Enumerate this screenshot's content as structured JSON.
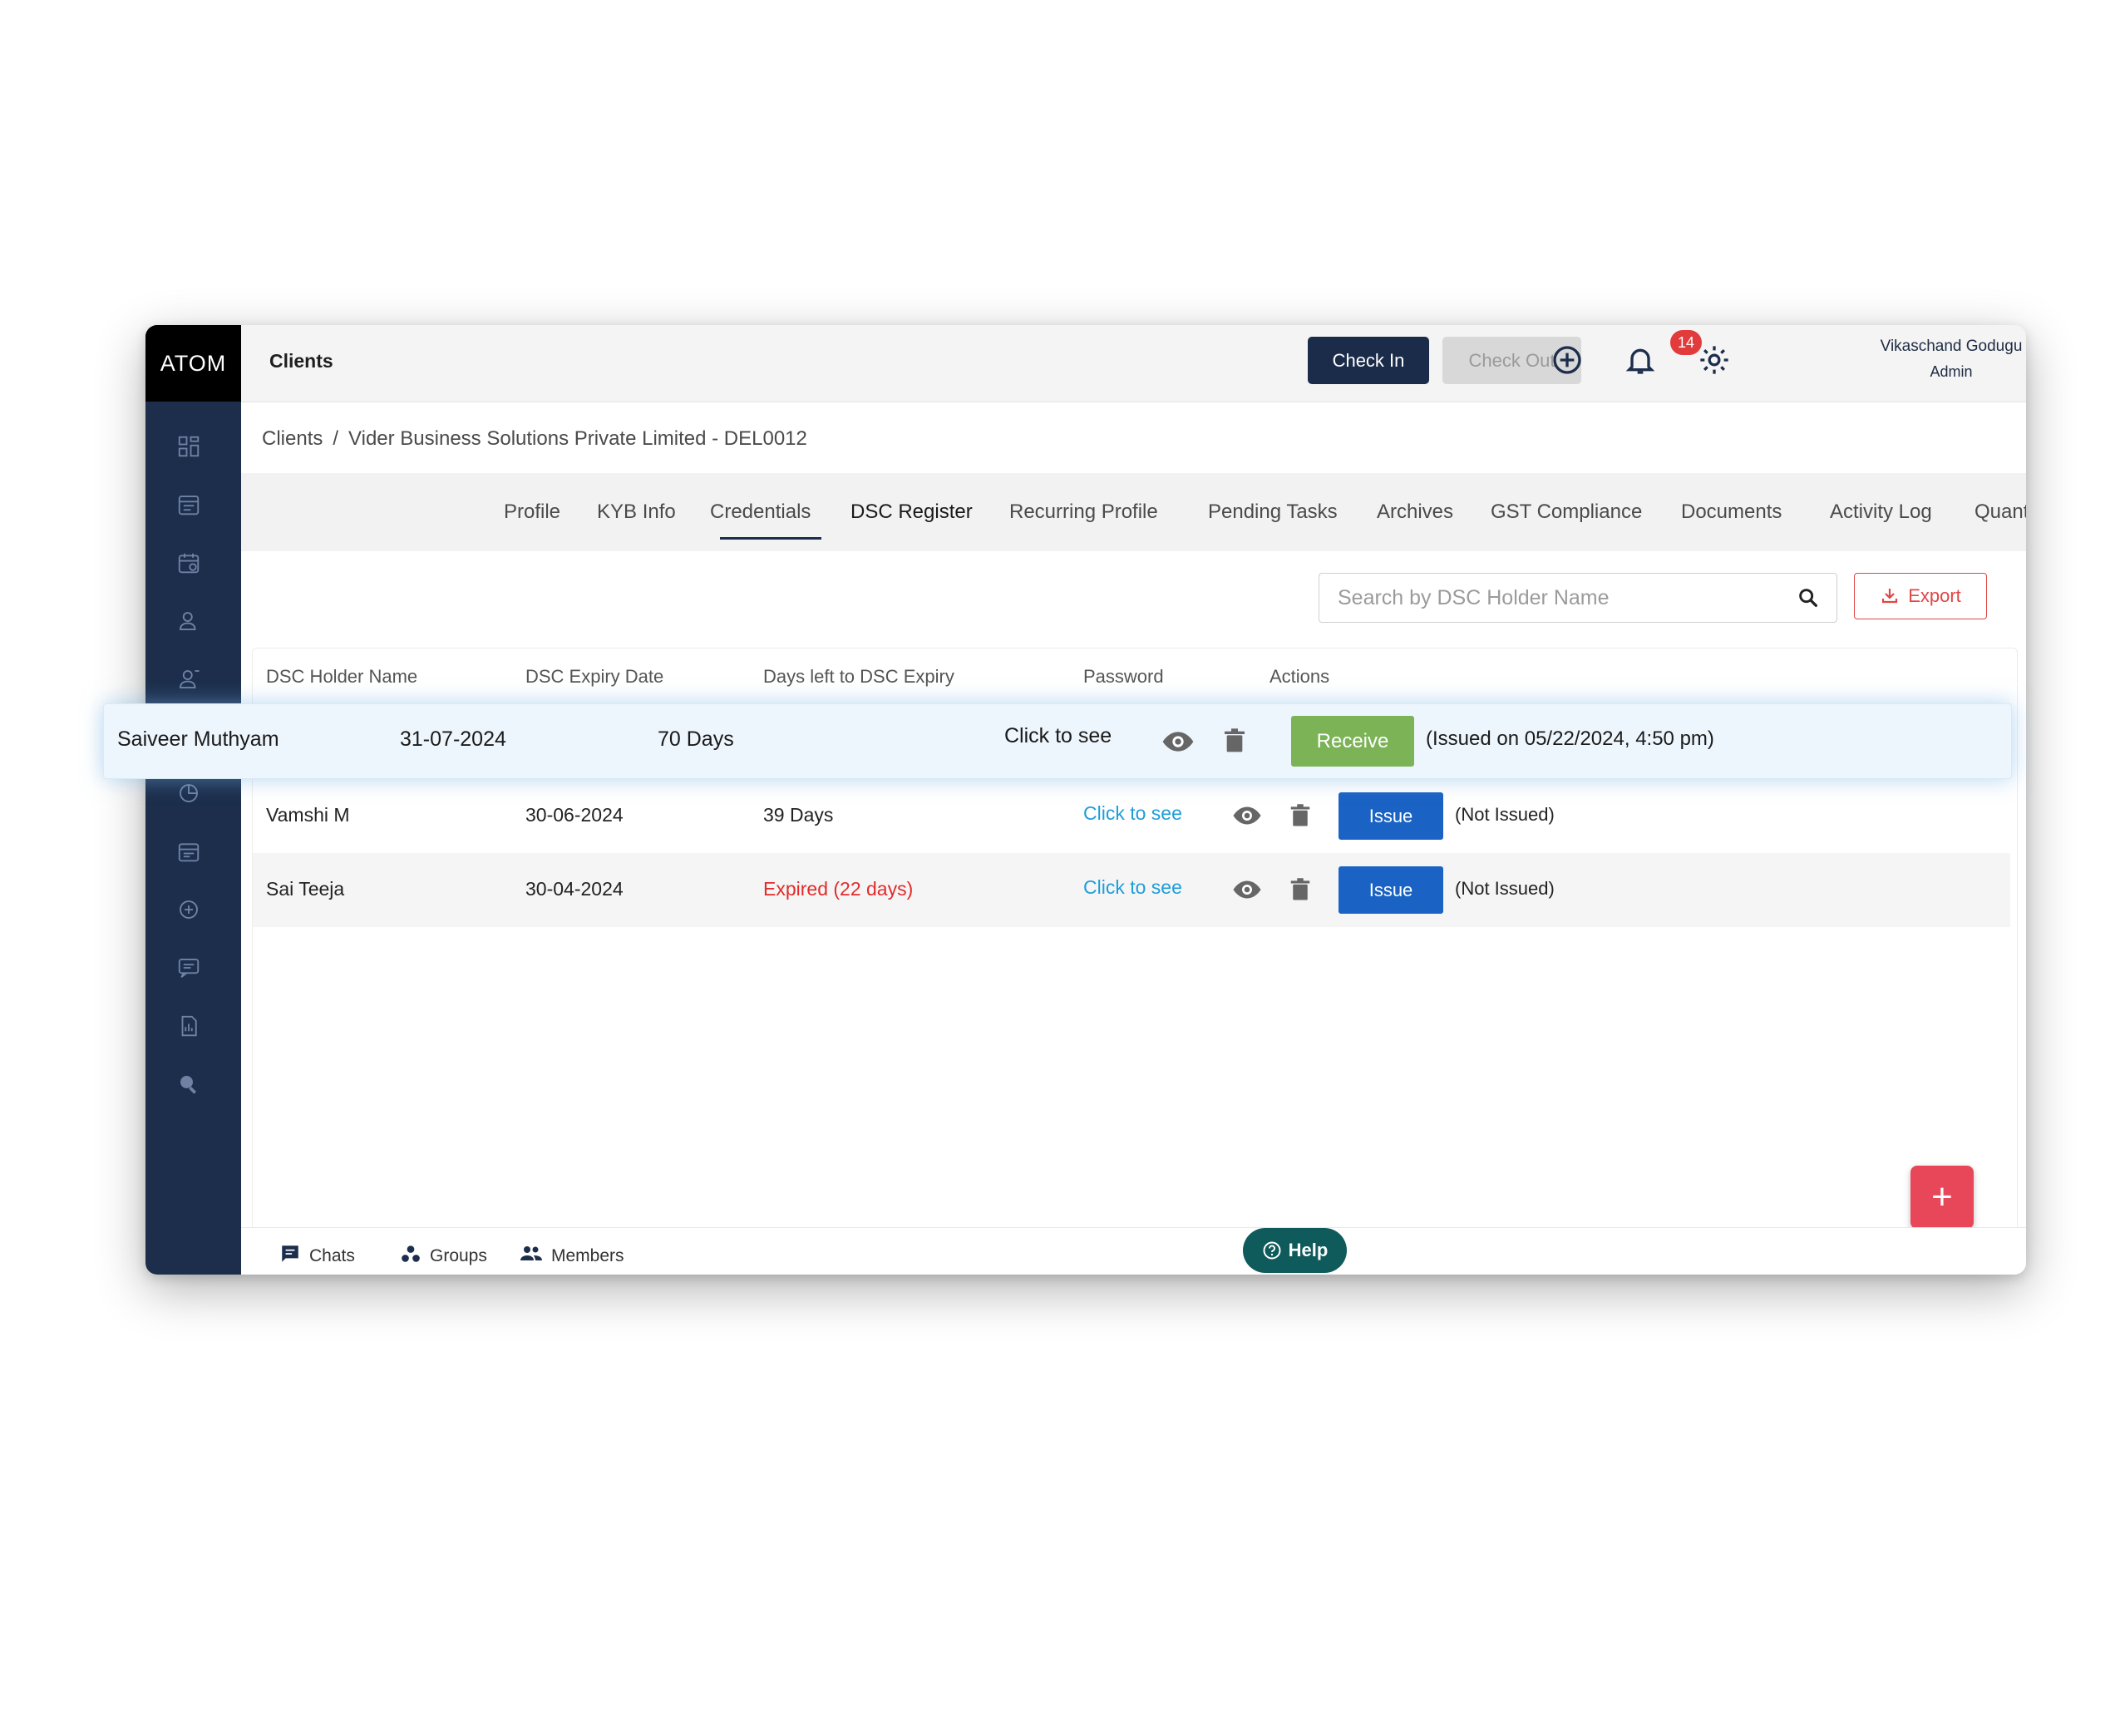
{
  "app": {
    "logo": "ATOM",
    "section_title": "Clients"
  },
  "topbar": {
    "check_in": "Check In",
    "check_out": "Check Out",
    "notification_count": "14",
    "user_name": "Vikaschand Godugu",
    "user_role": "Admin"
  },
  "breadcrumb": {
    "root": "Clients",
    "separator": "/",
    "current": "Vider Business Solutions Private Limited - DEL0012"
  },
  "tabs": [
    "Profile",
    "KYB Info",
    "Credentials",
    "DSC Register",
    "Recurring Profile",
    "Pending Tasks",
    "Archives",
    "GST Compliance",
    "Documents",
    "Activity Log",
    "Quantum"
  ],
  "active_tab": "DSC Register",
  "search": {
    "placeholder": "Search by DSC Holder Name"
  },
  "export_label": "Export",
  "table": {
    "headers": [
      "DSC Holder Name",
      "DSC Expiry Date",
      "Days left to DSC Expiry",
      "Password",
      "Actions"
    ],
    "rows": [
      {
        "name": "Saiveer Muthyam",
        "expiry": "31-07-2024",
        "days_left": "70 Days",
        "password": "Click to see",
        "action": "Receive",
        "status": "(Issued on 05/22/2024, 4:50 pm)"
      },
      {
        "name": "Vamshi M",
        "expiry": "30-06-2024",
        "days_left": "39 Days",
        "password": "Click to see",
        "action": "Issue",
        "status": "(Not Issued)"
      },
      {
        "name": "Sai Teeja",
        "expiry": "30-04-2024",
        "days_left": "Expired (22 days)",
        "password": "Click to see",
        "action": "Issue",
        "status": "(Not Issued)"
      }
    ]
  },
  "fab_label": "+",
  "footer": {
    "chats": "Chats",
    "groups": "Groups",
    "members": "Members",
    "help": "Help"
  },
  "colors": {
    "sidebar": "#1c2e4c",
    "primary": "#1b2c4a",
    "issue_button": "#1a63c4",
    "receive_button": "#7bb356",
    "link": "#1e9ed9",
    "expired": "#e22b2b",
    "export": "#e24545",
    "fab": "#e8475a",
    "help": "#0f5a5a"
  },
  "icons": {
    "sidebar": [
      "dashboard-icon",
      "tasks-icon",
      "calendar-icon",
      "clients-icon",
      "users-icon",
      "analytics-icon",
      "events-icon",
      "compliance-icon",
      "messages-icon",
      "reports-icon",
      "search-icon"
    ],
    "row_actions": [
      "eye-icon",
      "trash-icon"
    ]
  }
}
